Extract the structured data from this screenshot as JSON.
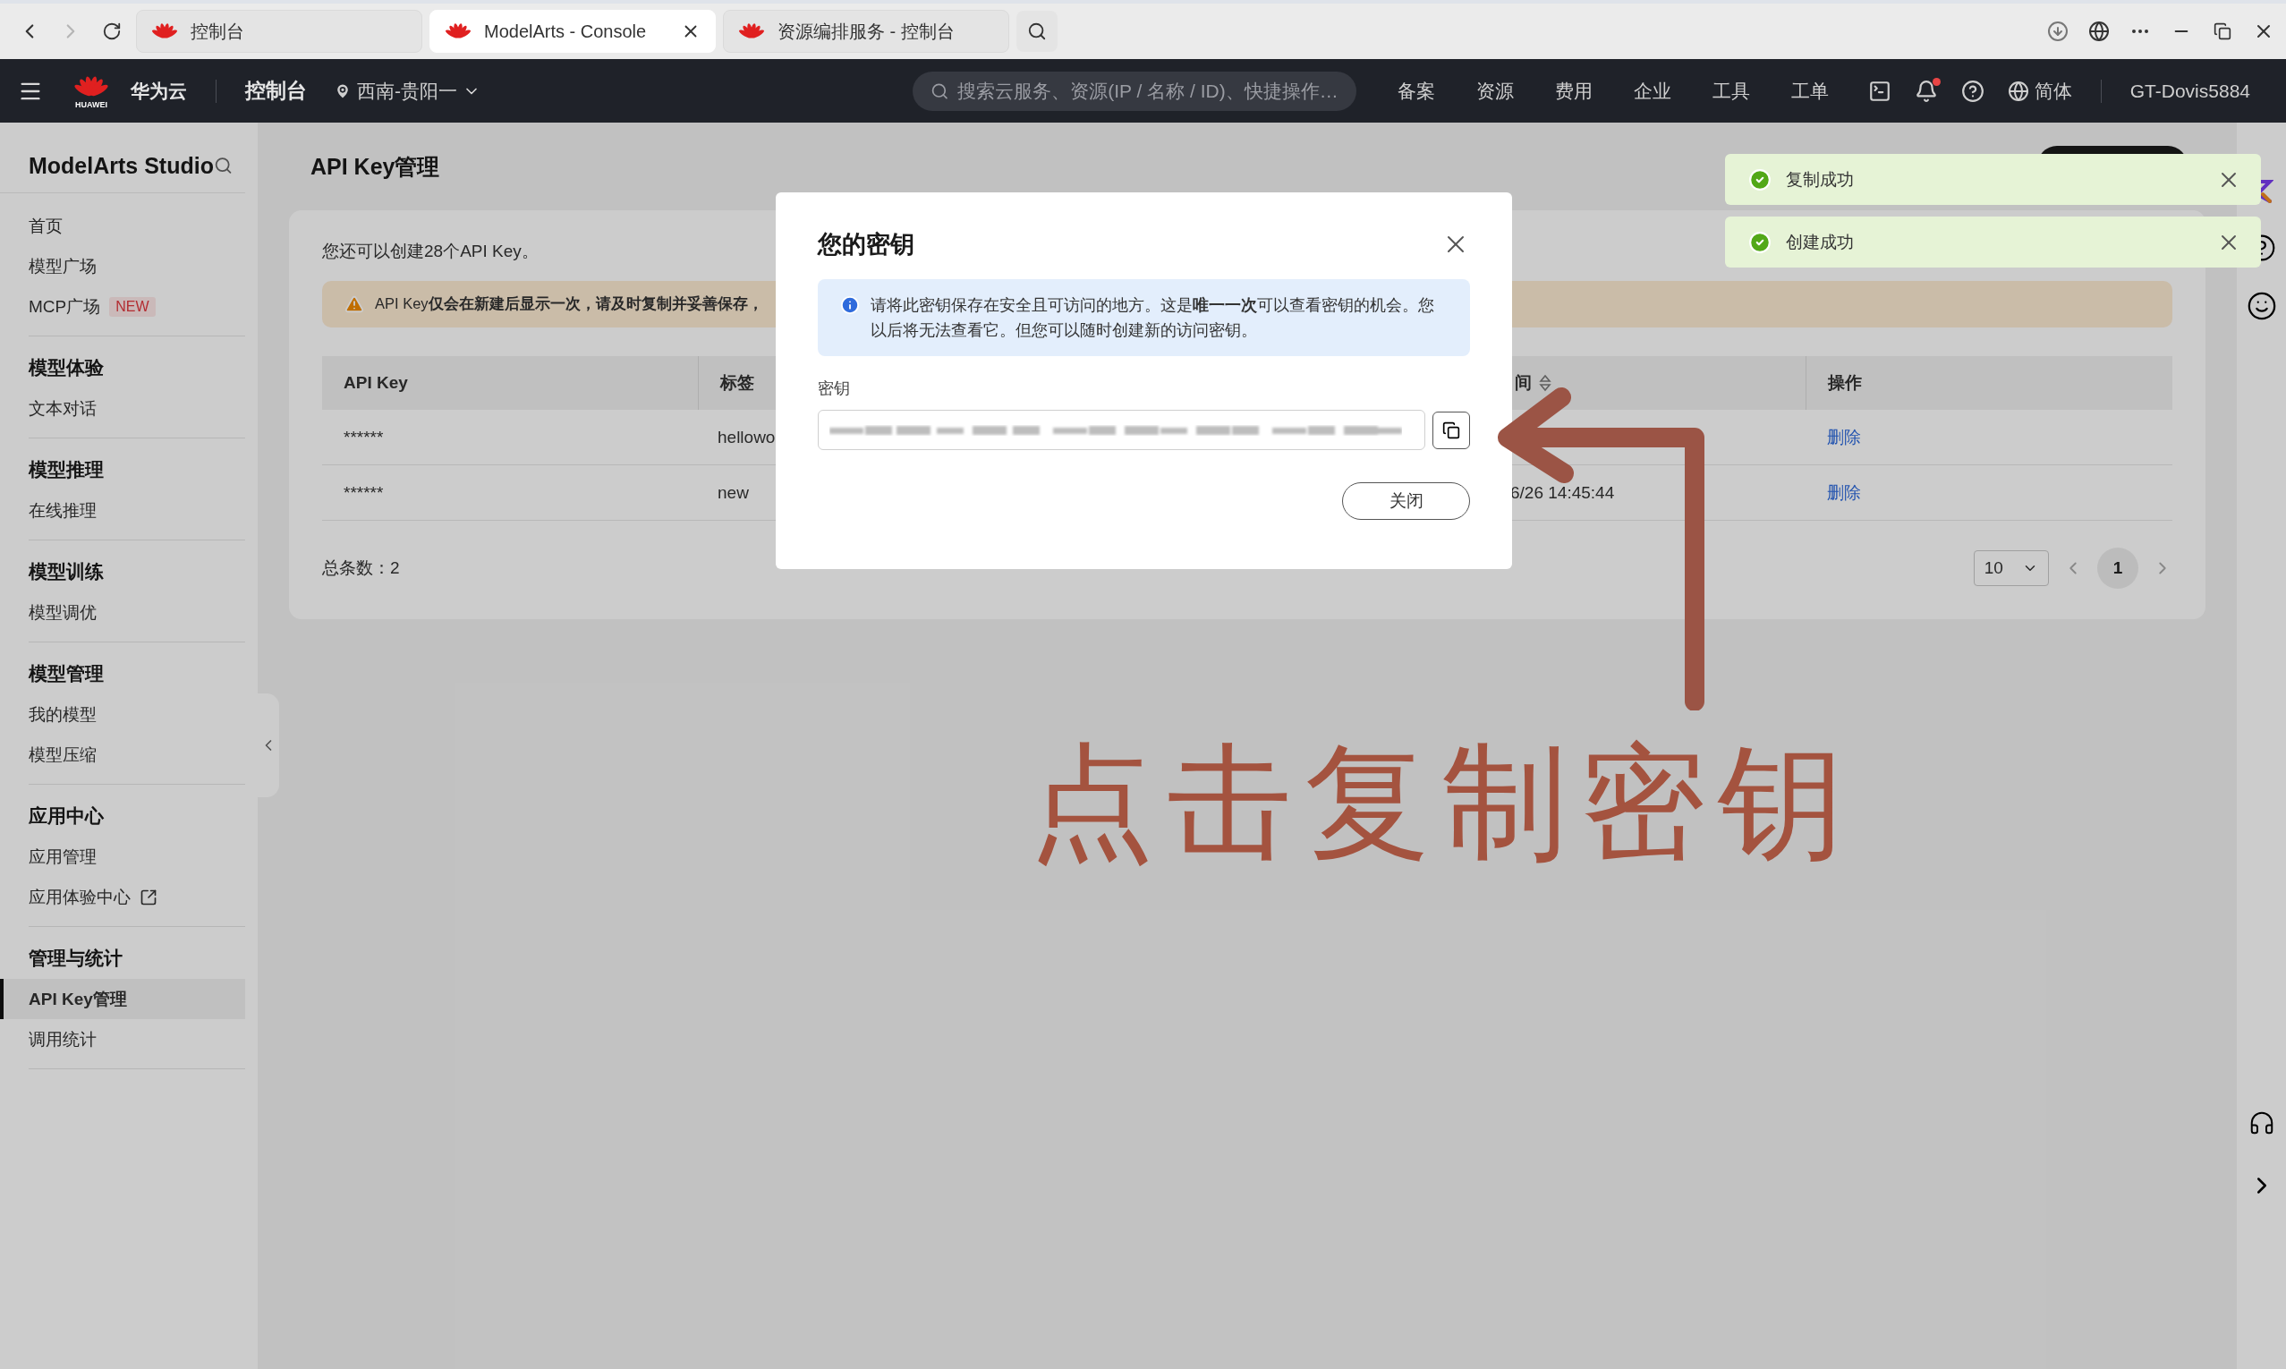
{
  "browser": {
    "tabs": [
      {
        "title": "控制台",
        "selected": false
      },
      {
        "title": "ModelArts - Console",
        "selected": true
      },
      {
        "title": "资源编排服务 - 控制台",
        "selected": false
      }
    ]
  },
  "nav": {
    "logo_caption": "HUAWEI",
    "brand": "华为云",
    "console": "控制台",
    "region": "西南-贵阳一",
    "search_placeholder": "搜索云服务、资源(IP / 名称 / ID)、快捷操作…",
    "links": [
      "备案",
      "资源",
      "费用",
      "企业",
      "工具",
      "工单"
    ],
    "notification_dot": true,
    "language": "简体",
    "user": "GT-Dovis5884"
  },
  "sidebar": {
    "title": "ModelArts Studio",
    "sections": [
      {
        "items": [
          {
            "label": "首页",
            "selected": false
          },
          {
            "label": "模型广场",
            "selected": false
          },
          {
            "label": "MCP广场",
            "badge": "NEW",
            "selected": false
          }
        ]
      },
      {
        "heading": "模型体验",
        "items": [
          {
            "label": "文本对话",
            "selected": false
          }
        ]
      },
      {
        "heading": "模型推理",
        "items": [
          {
            "label": "在线推理",
            "selected": false
          }
        ]
      },
      {
        "heading": "模型训练",
        "items": [
          {
            "label": "模型调优",
            "selected": false
          }
        ]
      },
      {
        "heading": "模型管理",
        "items": [
          {
            "label": "我的模型",
            "selected": false
          },
          {
            "label": "模型压缩",
            "selected": false
          }
        ]
      },
      {
        "heading": "应用中心",
        "items": [
          {
            "label": "应用管理",
            "selected": false
          },
          {
            "label": "应用体验中心",
            "kind": "external",
            "selected": false
          }
        ]
      },
      {
        "heading": "管理与统计",
        "items": [
          {
            "label": "API Key管理",
            "selected": true
          },
          {
            "label": "调用统计",
            "selected": false
          }
        ]
      }
    ]
  },
  "page": {
    "title": "API Key管理",
    "quota_note": "您还可以创建28个API Key。",
    "warning": "API Key**仅会在新建后显示一次，请及时复制并妥善保存，**",
    "table": {
      "columns": [
        {
          "label": "API Key",
          "sortable": false
        },
        {
          "label": "标签",
          "sortable": false
        },
        {
          "label": "间",
          "sortable": true
        },
        {
          "label": "操作",
          "sortable": false
        }
      ],
      "rows": [
        {
          "key": "******",
          "tag": "hellowo",
          "action": "删除"
        },
        {
          "key": "******",
          "tag": "new",
          "created": "6/26 14:45:44",
          "action": "删除"
        }
      ]
    },
    "total": "总条数：2",
    "page_size": "10",
    "pages": [
      {
        "label": "1",
        "selected": true
      }
    ]
  },
  "modal": {
    "title": "您的密钥",
    "notice": "请将此密钥保存在安全且可访问的地方。这是**唯一一次**可以查看密钥的机会。您以后将无法查看它。但您可以随时创建新的访问密钥。",
    "field_label": "密钥",
    "close_button": "关闭"
  },
  "toasts": [
    {
      "message": "复制成功"
    },
    {
      "message": "创建成功"
    }
  ],
  "annotation": {
    "text": "点击复制密钥"
  }
}
